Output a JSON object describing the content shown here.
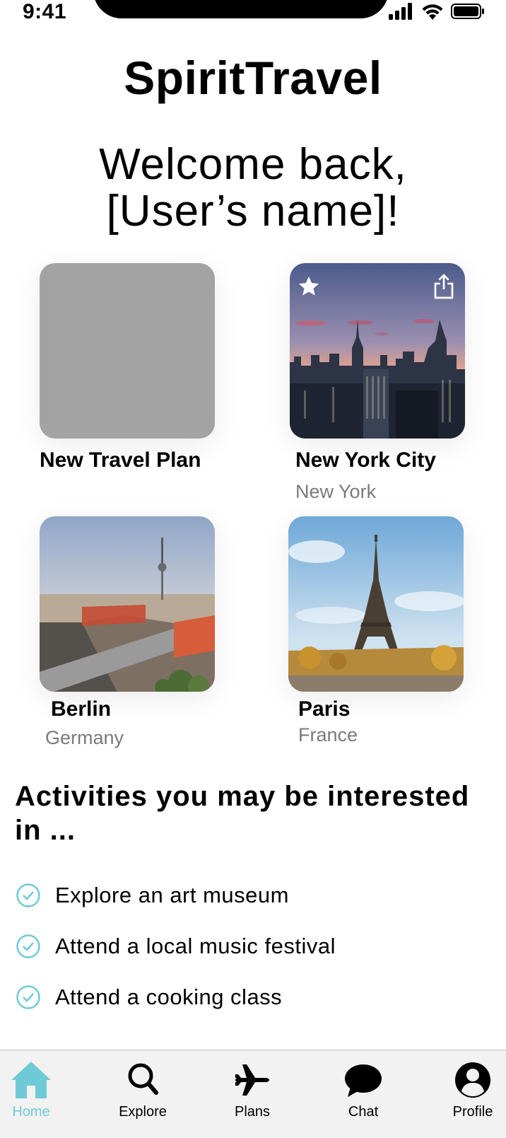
{
  "status_bar": {
    "time": "9:41"
  },
  "app": {
    "title": "SpiritTravel"
  },
  "welcome": {
    "line1": "Welcome back,",
    "line2": "[User’s name]!"
  },
  "cards": [
    {
      "title": "New Travel Plan",
      "subtitle": ""
    },
    {
      "title": "New York City",
      "subtitle": "New York"
    },
    {
      "title": "Berlin",
      "subtitle": "Germany"
    },
    {
      "title": "Paris",
      "subtitle": "France"
    }
  ],
  "activities": {
    "heading": "Activities you may be interested in ...",
    "items": [
      {
        "label": "Explore an art museum"
      },
      {
        "label": "Attend a local music festival"
      },
      {
        "label": "Attend a cooking class"
      }
    ]
  },
  "tab_bar": {
    "tabs": [
      {
        "label": "Home",
        "icon": "home-icon",
        "active": true
      },
      {
        "label": "Explore",
        "icon": "search-icon",
        "active": false
      },
      {
        "label": "Plans",
        "icon": "airplane-icon",
        "active": false
      },
      {
        "label": "Chat",
        "icon": "chat-bubble-icon",
        "active": false
      },
      {
        "label": "Profile",
        "icon": "profile-icon",
        "active": false
      }
    ]
  },
  "colors": {
    "accent": "#6fcad7",
    "placeholder": "#a3a3a3",
    "subtitle": "#7a7a7a",
    "tab_bar_bg": "#f2f2f2"
  }
}
